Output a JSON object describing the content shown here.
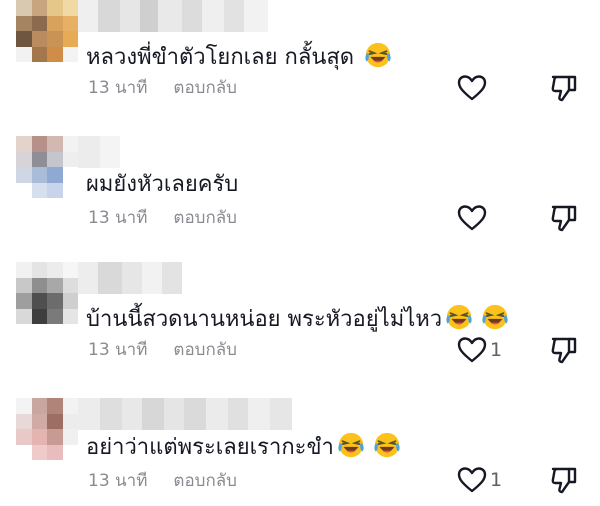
{
  "comments": [
    {
      "text": "หลวงพี่ขำตัวโยกเลย กลั้นสุด",
      "emojis": [
        "laughing-tears-emoji"
      ],
      "time": "13 นาที",
      "reply_label": "ตอบกลับ",
      "likes": ""
    },
    {
      "text": "ผมยังหัวเลยครับ",
      "emojis": [],
      "time": "13 นาที",
      "reply_label": "ตอบกลับ",
      "likes": ""
    },
    {
      "text": "บ้านนี้สวดนานหน่อย พระหัวอยู่ไม่ไหว",
      "emojis": [
        "laughing-tears-emoji",
        "laughing-tears-emoji"
      ],
      "time": "13 นาที",
      "reply_label": "ตอบกลับ",
      "likes": "1"
    },
    {
      "text": "อย่าว่าแต่พระเลยเรากะขำ",
      "emojis": [
        "laughing-tears-emoji",
        "laughing-tears-emoji"
      ],
      "time": "13 นาที",
      "reply_label": "ตอบกลับ",
      "likes": "1"
    }
  ],
  "icons": {
    "like": "heart-outline-icon",
    "dislike": "thumbs-down-outline-icon"
  },
  "colors": {
    "text": "#161823",
    "meta": "#8a8b91",
    "icon": "#161823"
  }
}
